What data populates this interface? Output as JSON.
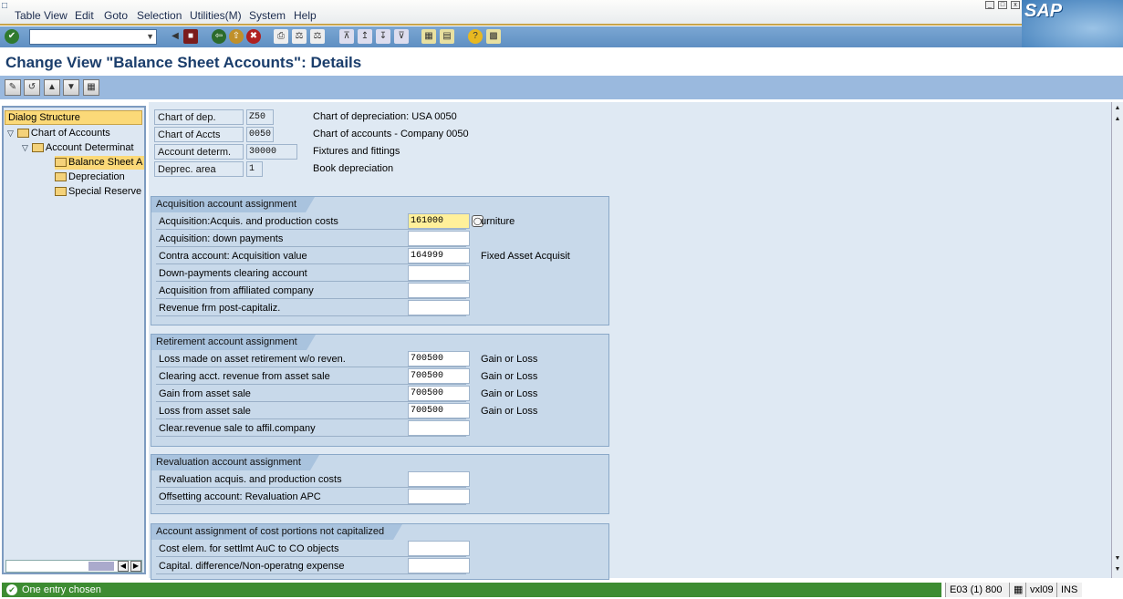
{
  "menu": [
    "Table View",
    "Edit",
    "Goto",
    "Selection",
    "Utilities(M)",
    "System",
    "Help"
  ],
  "window_title": "Change View \"Balance Sheet Accounts\": Details",
  "logo": "SAP",
  "command_field": {
    "value": "",
    "placeholder": ""
  },
  "dialog_structure": {
    "header": "Dialog Structure",
    "items": [
      {
        "label": "Chart of Accounts",
        "level": 0,
        "expanded": true
      },
      {
        "label": "Account Determinat",
        "level": 1,
        "expanded": true
      },
      {
        "label": "Balance Sheet A",
        "level": 2,
        "selected": true
      },
      {
        "label": "Depreciation",
        "level": 2
      },
      {
        "label": "Special Reserve",
        "level": 2
      }
    ]
  },
  "keys": [
    {
      "label": "Chart of dep.",
      "value": "Z50",
      "desc": "Chart of depreciation: USA 0050"
    },
    {
      "label": "Chart of Accts",
      "value": "0050",
      "desc": "Chart of accounts - Company 0050"
    },
    {
      "label": "Account determ.",
      "value": "30000",
      "desc": "Fixtures and fittings"
    },
    {
      "label": "Deprec. area",
      "value": "1",
      "desc": "Book depreciation"
    }
  ],
  "groups": {
    "acquisition": {
      "title": "Acquisition account assignment",
      "rows": [
        {
          "label": "Acquisition:Acquis. and production costs",
          "value": "161000",
          "desc": "urniture"
        },
        {
          "label": "Acquisition: down payments",
          "value": "",
          "desc": ""
        },
        {
          "label": "Contra account: Acquisition value",
          "value": "164999",
          "desc": "Fixed Asset Acquisit"
        },
        {
          "label": "Down-payments clearing account",
          "value": "",
          "desc": ""
        },
        {
          "label": "Acquisition from affiliated company",
          "value": "",
          "desc": ""
        },
        {
          "label": "Revenue frm post-capitaliz.",
          "value": "",
          "desc": ""
        }
      ]
    },
    "retirement": {
      "title": "Retirement account assignment",
      "rows": [
        {
          "label": "Loss made on asset retirement w/o reven.",
          "value": "700500",
          "desc": "Gain or Loss"
        },
        {
          "label": "Clearing acct. revenue from asset sale",
          "value": "700500",
          "desc": "Gain or Loss"
        },
        {
          "label": "Gain from asset sale",
          "value": "700500",
          "desc": "Gain or Loss"
        },
        {
          "label": "Loss from asset sale",
          "value": "700500",
          "desc": "Gain or Loss"
        },
        {
          "label": "Clear.revenue sale to affil.company",
          "value": "",
          "desc": ""
        }
      ]
    },
    "revaluation": {
      "title": "Revaluation account assignment",
      "rows": [
        {
          "label": "Revaluation acquis. and production costs",
          "value": "",
          "desc": ""
        },
        {
          "label": "Offsetting account: Revaluation APC",
          "value": "",
          "desc": ""
        }
      ]
    },
    "cost_portions": {
      "title": "Account assignment of cost portions not capitalized",
      "rows": [
        {
          "label": "Cost elem. for settlmt AuC to CO objects",
          "value": "",
          "desc": ""
        },
        {
          "label": "Capital. difference/Non-operatng expense",
          "value": "",
          "desc": ""
        }
      ]
    }
  },
  "status": {
    "message": "One entry chosen",
    "system": "E03 (1) 800",
    "server": "vxl09",
    "mode": "INS"
  },
  "colors": {
    "accent": "#1a3d6b",
    "status_ok": "#3d8c32",
    "focus_field": "#fff09a"
  }
}
